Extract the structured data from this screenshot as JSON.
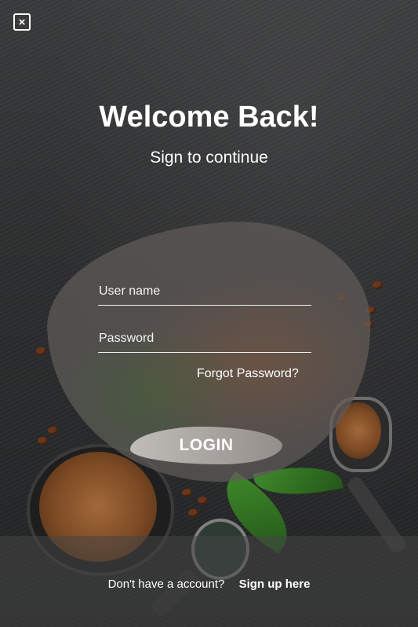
{
  "close_button": {
    "icon": "close-icon",
    "glyph": "×"
  },
  "header": {
    "title": "Welcome Back!",
    "subtitle": "Sign to continue"
  },
  "form": {
    "username_placeholder": "User name",
    "password_placeholder": "Password",
    "forgot_password": "Forgot Password?",
    "login_label": "LOGIN"
  },
  "footer": {
    "prompt": "Don't have a account?",
    "signup_link": "Sign up here"
  }
}
